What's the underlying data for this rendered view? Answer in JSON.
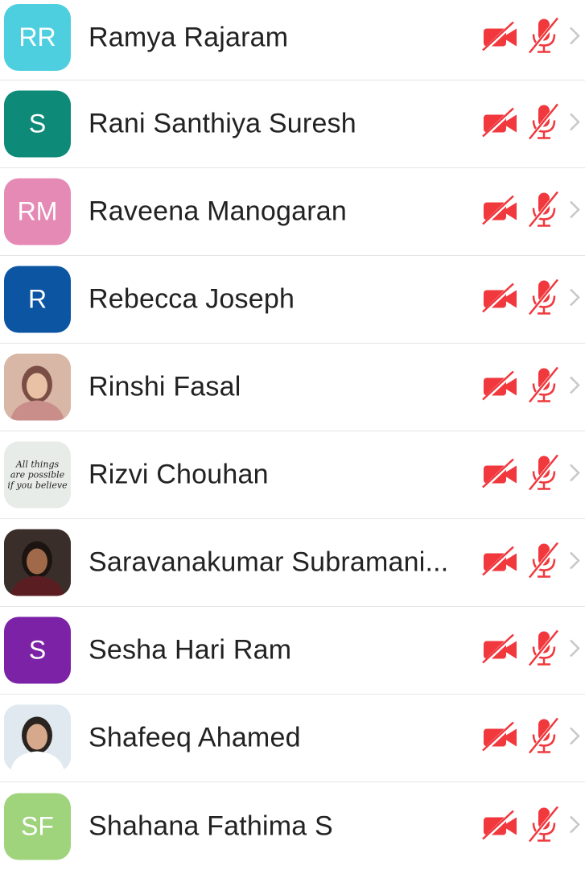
{
  "participants": [
    {
      "name": "Ramya Rajaram",
      "initials": "RR",
      "avatar_color": "#4ecfe0",
      "avatar_type": "initials"
    },
    {
      "name": "Rani Santhiya Suresh",
      "initials": "S",
      "avatar_color": "#0e8a78",
      "avatar_type": "initials"
    },
    {
      "name": "Raveena Manogaran",
      "initials": "RM",
      "avatar_color": "#e58ab5",
      "avatar_type": "initials"
    },
    {
      "name": "Rebecca Joseph",
      "initials": "R",
      "avatar_color": "#0b55a3",
      "avatar_type": "initials"
    },
    {
      "name": "Rinshi Fasal",
      "initials": "",
      "avatar_color": "#c9a08b",
      "avatar_type": "photo-person"
    },
    {
      "name": "Rizvi Chouhan",
      "initials": "",
      "avatar_color": "#e8ece8",
      "avatar_type": "quote-image",
      "avatar_text": [
        "All things",
        "are possible",
        "if you believe"
      ]
    },
    {
      "name": "Saravanakumar Subramani...",
      "initials": "",
      "avatar_color": "#6b4a3a",
      "avatar_type": "photo-person"
    },
    {
      "name": "Sesha Hari Ram",
      "initials": "S",
      "avatar_color": "#7b22a6",
      "avatar_type": "initials"
    },
    {
      "name": "Shafeeq Ahamed",
      "initials": "",
      "avatar_color": "#cfe0ea",
      "avatar_type": "photo-person"
    },
    {
      "name": "Shahana Fathima S",
      "initials": "SF",
      "avatar_color": "#9fd37c",
      "avatar_type": "initials"
    }
  ],
  "icons": {
    "video": "video-off-icon",
    "mic": "mic-muted-icon",
    "chevron": "chevron-right-icon",
    "muted_color": "#f0383d",
    "chevron_color": "#c7c7cc"
  }
}
